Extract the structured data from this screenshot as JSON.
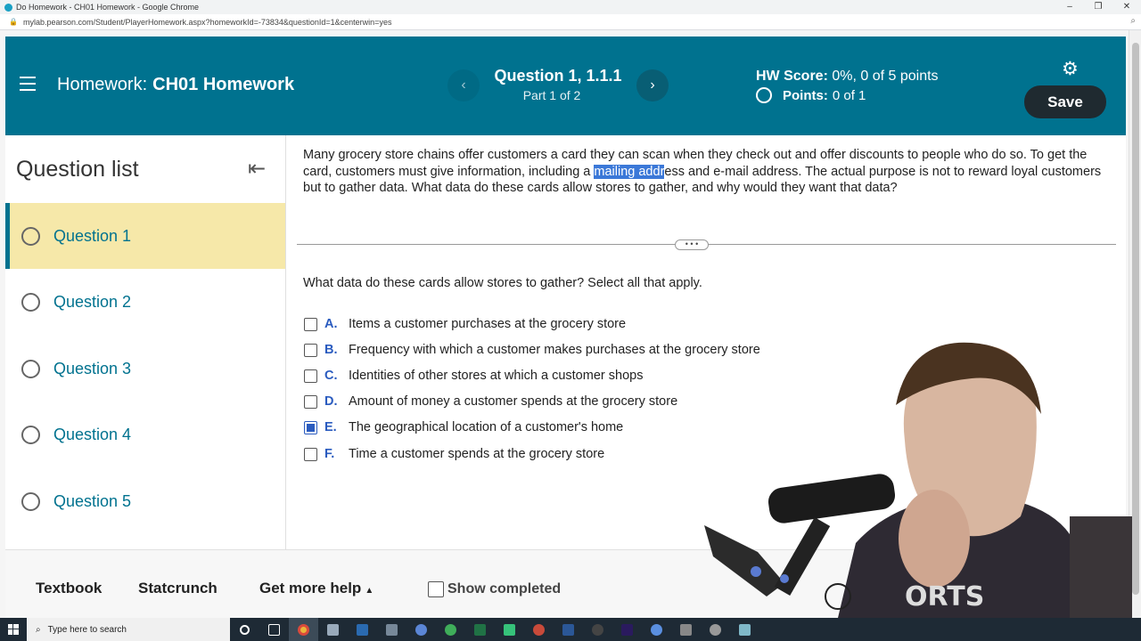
{
  "browser": {
    "window_title": "Do Homework - CH01 Homework - Google Chrome",
    "url": "mylab.pearson.com/Student/PlayerHomework.aspx?homeworkId=-73834&questionId=1&centerwin=yes"
  },
  "header": {
    "hw_label": "Homework:",
    "hw_name": "CH01 Homework",
    "question_title": "Question 1, 1.1.1",
    "question_part": "Part 1 of 2",
    "hw_score_label": "HW Score:",
    "hw_score_value": "0%, 0 of 5 points",
    "points_label": "Points:",
    "points_value": "0 of 1",
    "save_label": "Save"
  },
  "sidebar": {
    "title": "Question list",
    "items": [
      {
        "label": "Question 1",
        "active": true
      },
      {
        "label": "Question 2",
        "active": false
      },
      {
        "label": "Question 3",
        "active": false
      },
      {
        "label": "Question 4",
        "active": false
      },
      {
        "label": "Question 5",
        "active": false
      }
    ]
  },
  "question": {
    "passage_before": "Many grocery store chains offer customers a card they can scan when they check out and offer discounts to people who do so. To get the card, customers must give information, including a ",
    "passage_highlight": "mailing addr",
    "passage_after": "ess and e-mail address. The actual purpose is not to reward loyal customers but to gather data. What data do these cards allow stores to gather, and why would they want that data?",
    "expander": "• • •",
    "prompt": "What data do these cards allow stores to gather? Select all that apply.",
    "options": [
      {
        "letter": "A.",
        "text": "Items a customer purchases at the grocery store",
        "checked": false
      },
      {
        "letter": "B.",
        "text": "Frequency with which a customer makes purchases at the grocery store",
        "checked": false
      },
      {
        "letter": "C.",
        "text": "Identities of other stores at which a customer shops",
        "checked": false
      },
      {
        "letter": "D.",
        "text": "Amount of money a customer spends at the grocery store",
        "checked": false
      },
      {
        "letter": "E.",
        "text": "The geographical location of a customer's home",
        "checked": true
      },
      {
        "letter": "F.",
        "text": "Time a customer spends at the grocery store",
        "checked": false
      }
    ]
  },
  "bottombar": {
    "textbook": "Textbook",
    "statcrunch": "Statcrunch",
    "get_more_help": "Get more help",
    "show_completed": "Show completed"
  },
  "taskbar": {
    "search_placeholder": "Type here to search"
  },
  "colors": {
    "header_teal": "#00728f",
    "active_question_bg": "#f6e8a9",
    "save_button": "#1f2a30",
    "option_letter_blue": "#2a5bbf",
    "highlight_blue": "#3b78d8"
  }
}
